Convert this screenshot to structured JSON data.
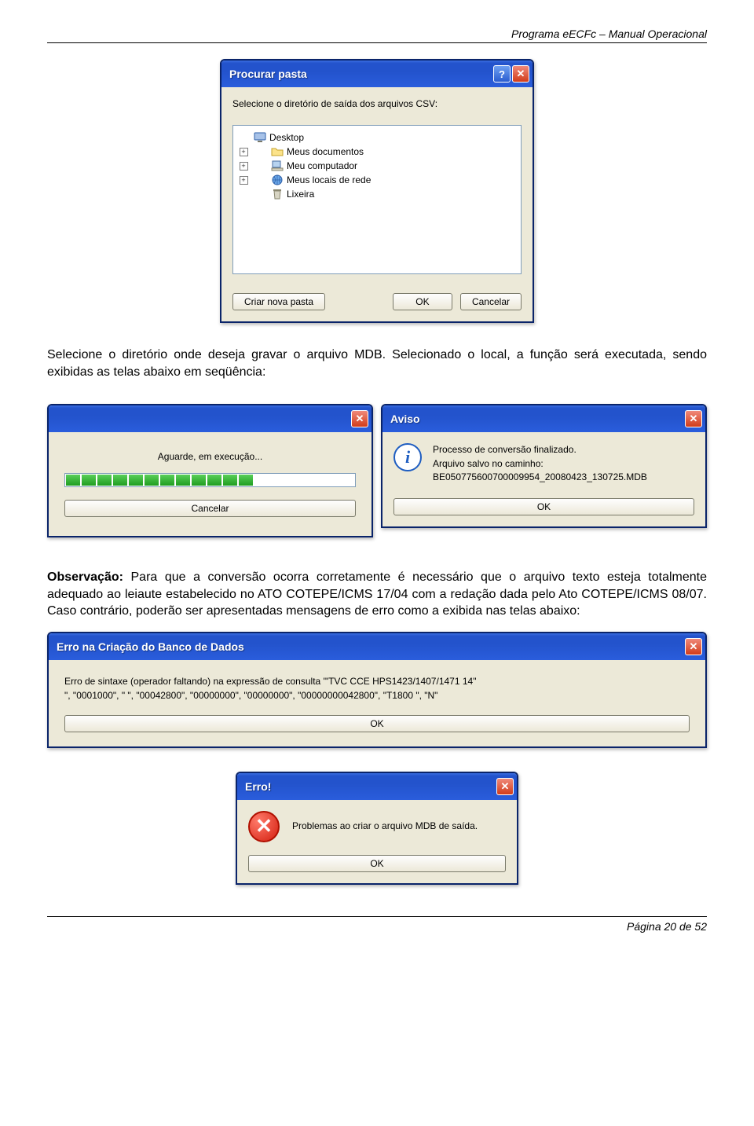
{
  "header": {
    "text": "Programa eECFc – Manual Operacional"
  },
  "footer": {
    "text": "Página 20 de 52"
  },
  "browse": {
    "title": "Procurar pasta",
    "instruction": "Selecione o diretório de saída dos arquivos CSV:",
    "tree": {
      "desktop": "Desktop",
      "docs": "Meus documentos",
      "computer": "Meu computador",
      "network": "Meus locais de rede",
      "trash": "Lixeira"
    },
    "new_folder": "Criar nova pasta",
    "ok": "OK",
    "cancel": "Cancelar"
  },
  "para1": "Selecione o diretório onde deseja gravar o arquivo MDB. Selecionado o local, a função será executada, sendo exibidas as telas abaixo em seqüência:",
  "progress": {
    "title": "",
    "label": "Aguarde, em execução...",
    "cancel": "Cancelar"
  },
  "aviso": {
    "title": "Aviso",
    "line1": "Processo de conversão finalizado.",
    "line2": "Arquivo salvo no caminho:",
    "line3": "BE050775600700009954_20080423_130725.MDB",
    "ok": "OK"
  },
  "obs": {
    "label": "Observação:",
    "text": " Para que a conversão ocorra corretamente é necessário que o arquivo texto esteja totalmente adequado ao leiaute estabelecido no ATO COTEPE/ICMS 17/04 com a redação dada pelo Ato COTEPE/ICMS 08/07. Caso contrário, poderão ser apresentadas mensagens de erro como a exibida nas telas abaixo:"
  },
  "err1": {
    "title": "Erro na Criação do Banco de Dados",
    "line1": "Erro de sintaxe (operador faltando) na expressão de consulta '\"TVC CCE HPS1423/1407/1471 14\"",
    "line2": "\", \"0001000\", \"  \", \"00042800\", \"00000000\", \"00000000\", \"00000000042800\", \"T1800 \", \"N\"",
    "ok": "OK"
  },
  "err2": {
    "title": "Erro!",
    "text": "Problemas ao criar o arquivo MDB de saída.",
    "ok": "OK"
  }
}
